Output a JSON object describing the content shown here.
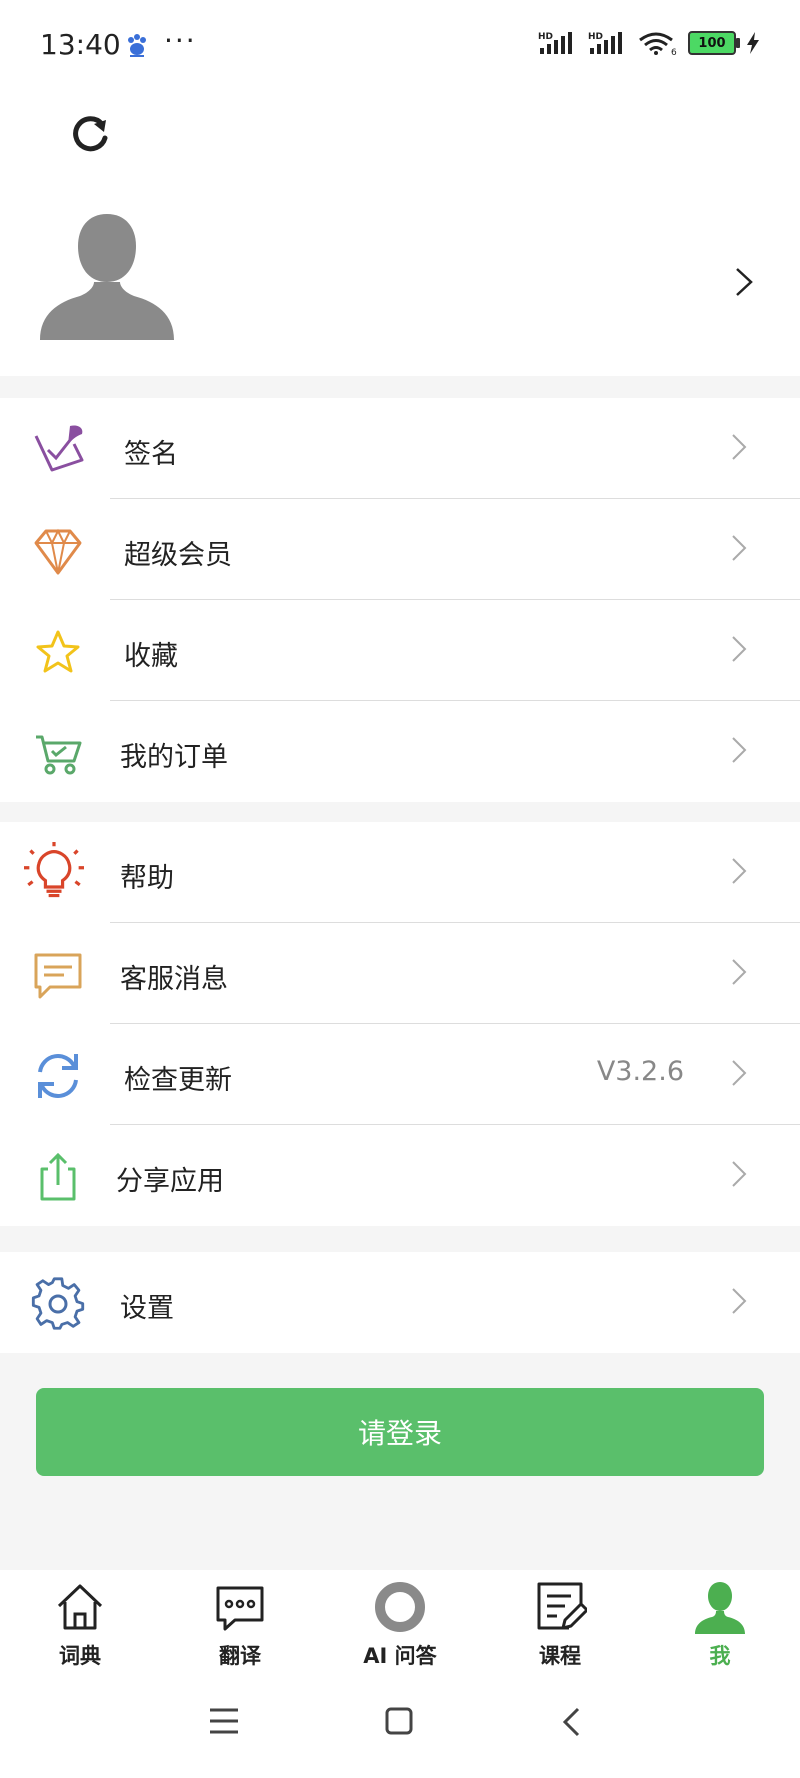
{
  "status_bar": {
    "time": "13:40",
    "more": "···",
    "battery": "100",
    "network_label": "HD",
    "wifi_label": "6"
  },
  "profile": {
    "refresh_icon": "refresh-icon",
    "avatar_icon": "person-silhouette-icon",
    "chevron_icon": "chevron-right-icon"
  },
  "menu_group_1": [
    {
      "label": "签名",
      "icon": "signature-quill-icon",
      "color": "#8a4fa0"
    },
    {
      "label": "超级会员",
      "icon": "diamond-icon",
      "color": "#e08a4a"
    },
    {
      "label": "收藏",
      "icon": "star-icon",
      "color": "#f2c31a"
    },
    {
      "label": "我的订单",
      "icon": "cart-icon",
      "color": "#5aa86a"
    }
  ],
  "menu_group_2": [
    {
      "label": "帮助",
      "icon": "lightbulb-icon",
      "color": "#d9452a"
    },
    {
      "label": "客服消息",
      "icon": "message-icon",
      "color": "#d9a45a"
    },
    {
      "label": "检查更新",
      "icon": "sync-icon",
      "color": "#5a8fd9",
      "value": "V3.2.6"
    },
    {
      "label": "分享应用",
      "icon": "share-icon",
      "color": "#5abf6b"
    }
  ],
  "menu_group_3": [
    {
      "label": "设置",
      "icon": "gear-icon",
      "color": "#4a6fa8"
    }
  ],
  "login_button": "请登录",
  "tabs": [
    {
      "label": "词典",
      "icon": "home-icon",
      "active": false
    },
    {
      "label": "翻译",
      "icon": "chat-bubble-icon",
      "active": false
    },
    {
      "label": "AI 问答",
      "icon": "ai-circle-icon",
      "active": false
    },
    {
      "label": "课程",
      "icon": "edit-document-icon",
      "active": false
    },
    {
      "label": "我",
      "icon": "person-icon",
      "active": true
    }
  ],
  "colors": {
    "accent": "#5abf6b",
    "active_tab": "#4caf50"
  }
}
